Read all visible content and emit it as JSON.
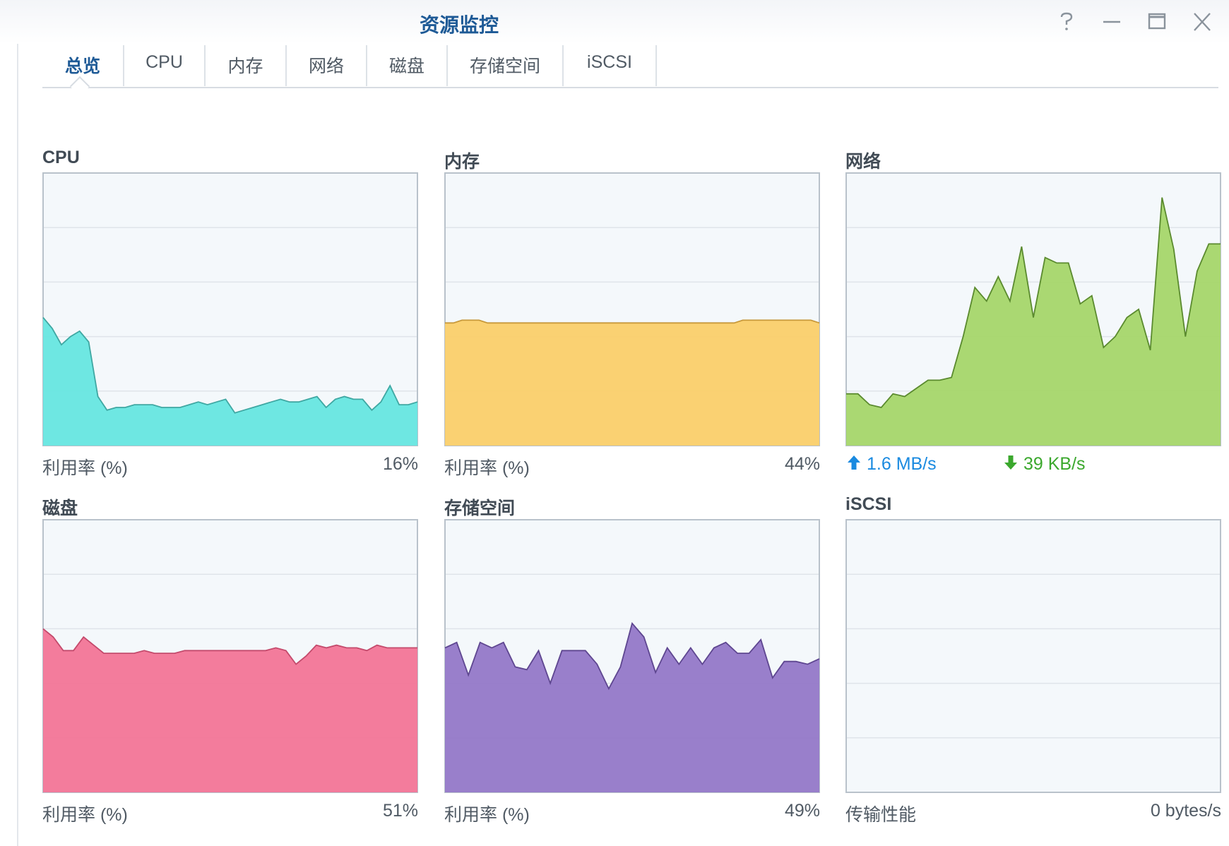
{
  "window": {
    "title": "资源监控",
    "controls": {
      "help": "help-icon",
      "minimize": "minimize-icon",
      "maximize": "maximize-icon",
      "close": "close-icon"
    }
  },
  "tabs": [
    {
      "label": "总览",
      "active": true
    },
    {
      "label": "CPU",
      "active": false
    },
    {
      "label": "内存",
      "active": false
    },
    {
      "label": "网络",
      "active": false
    },
    {
      "label": "磁盘",
      "active": false
    },
    {
      "label": "存储空间",
      "active": false
    },
    {
      "label": "iSCSI",
      "active": false
    }
  ],
  "panels": {
    "cpu": {
      "title": "CPU",
      "metric_label": "利用率 (%)",
      "value": "16%"
    },
    "memory": {
      "title": "内存",
      "metric_label": "利用率 (%)",
      "value": "44%"
    },
    "network": {
      "title": "网络",
      "upload": "1.6 MB/s",
      "download": "39 KB/s",
      "upload_icon": "upload-arrow-icon",
      "download_icon": "download-arrow-icon"
    },
    "disk": {
      "title": "磁盘",
      "metric_label": "利用率 (%)",
      "value": "51%"
    },
    "volume": {
      "title": "存储空间",
      "metric_label": "利用率 (%)",
      "value": "49%"
    },
    "iscsi": {
      "title": "iSCSI",
      "metric_label": "传输性能",
      "value": "0 bytes/s"
    }
  },
  "colors": {
    "cpu": "#66e6e0",
    "cpu_line": "#3fa7a2",
    "memory": "#facf6a",
    "memory_line": "#c8993a",
    "network": "#a5d66a",
    "network_line": "#5a8a2e",
    "disk": "#f27597",
    "disk_line": "#c44a6c",
    "volume": "#9378c8",
    "volume_line": "#5e4690",
    "plot_bg": "#f4f8fb",
    "grid": "#dfe4ea",
    "accent": "#1e5a96",
    "upload": "#1a8ae0",
    "download": "#3ba82d"
  },
  "chart_data": [
    {
      "type": "area",
      "name": "cpu",
      "title": "CPU",
      "ylim": [
        0,
        100
      ],
      "values": [
        47,
        43,
        37,
        40,
        42,
        38,
        18,
        13,
        14,
        14,
        15,
        15,
        15,
        14,
        14,
        14,
        15,
        16,
        15,
        16,
        17,
        12,
        13,
        14,
        15,
        16,
        17,
        16,
        16,
        17,
        18,
        14,
        17,
        18,
        17,
        17,
        13,
        16,
        22,
        15,
        15,
        16
      ]
    },
    {
      "type": "area",
      "name": "memory",
      "title": "内存",
      "ylim": [
        0,
        100
      ],
      "values": [
        45,
        45,
        46,
        46,
        46,
        45,
        45,
        45,
        45,
        45,
        45,
        45,
        45,
        45,
        45,
        45,
        45,
        45,
        45,
        45,
        45,
        45,
        45,
        45,
        45,
        45,
        45,
        45,
        45,
        45,
        45,
        45,
        45,
        45,
        45,
        46,
        46,
        46,
        46,
        46,
        46,
        46,
        46,
        46,
        45
      ]
    },
    {
      "type": "area",
      "name": "network",
      "title": "网络",
      "ylim": [
        0,
        100
      ],
      "values": [
        19,
        19,
        15,
        14,
        19,
        18,
        21,
        24,
        24,
        25,
        40,
        58,
        53,
        62,
        53,
        73,
        47,
        69,
        67,
        67,
        52,
        55,
        36,
        40,
        47,
        50,
        35,
        91,
        72,
        40,
        64,
        74,
        74
      ]
    },
    {
      "type": "area",
      "name": "disk",
      "title": "磁盘",
      "ylim": [
        0,
        100
      ],
      "values": [
        60,
        57,
        52,
        52,
        57,
        54,
        51,
        51,
        51,
        51,
        52,
        51,
        51,
        51,
        52,
        52,
        52,
        52,
        52,
        52,
        52,
        52,
        52,
        53,
        52,
        47,
        50,
        54,
        53,
        54,
        53,
        53,
        52,
        54,
        53,
        53,
        53,
        53
      ]
    },
    {
      "type": "area",
      "name": "volume",
      "title": "存储空间",
      "ylim": [
        0,
        100
      ],
      "values": [
        53,
        55,
        43,
        55,
        53,
        55,
        46,
        45,
        52,
        40,
        52,
        52,
        52,
        47,
        38,
        46,
        62,
        57,
        44,
        53,
        47,
        53,
        47,
        53,
        55,
        51,
        51,
        56,
        42,
        48,
        48,
        47,
        49
      ]
    },
    {
      "type": "area",
      "name": "iscsi",
      "title": "iSCSI",
      "ylim": [
        0,
        100
      ],
      "values": []
    }
  ]
}
